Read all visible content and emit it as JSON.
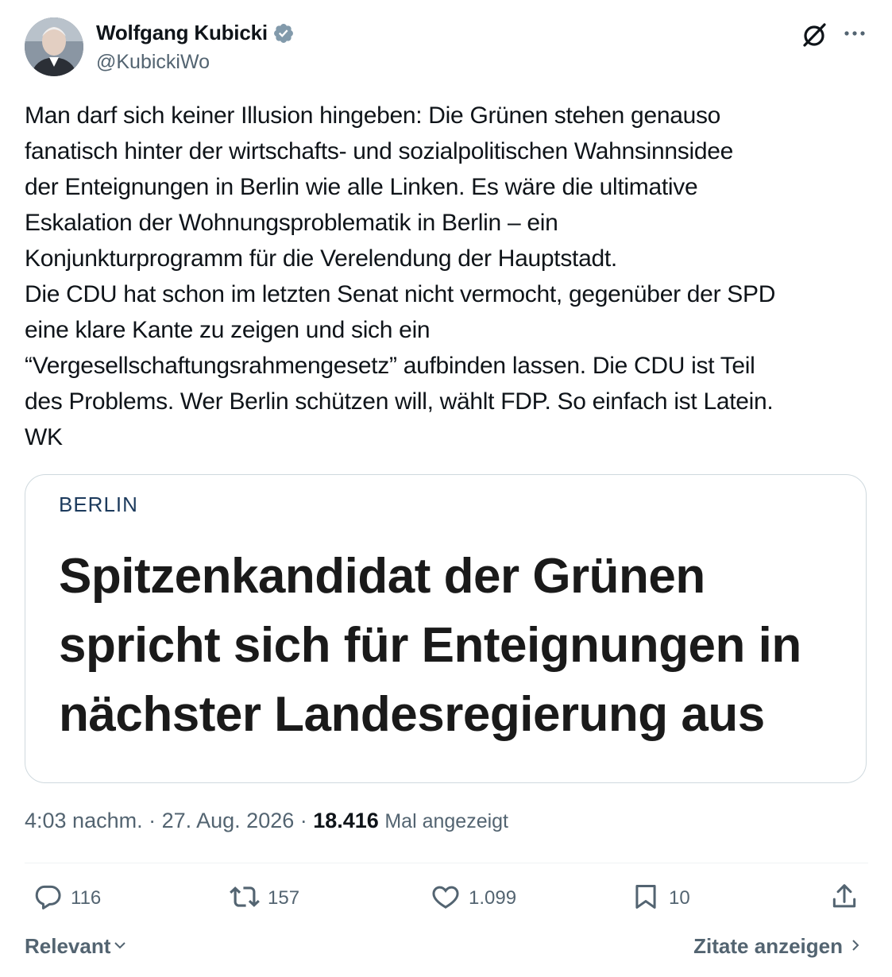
{
  "author": {
    "name": "Wolfgang Kubicki",
    "handle": "@KubickiWo",
    "verified_color": "#829aab"
  },
  "tweet": {
    "lines": [
      "Man darf sich keiner Illusion hingeben: Die Grünen stehen genauso",
      "fanatisch hinter der wirtschafts- und sozialpolitischen Wahnsinnsidee",
      "der Enteignungen in Berlin wie alle Linken. Es wäre die ultimative",
      "Eskalation der Wohnungsproblematik in Berlin – ein",
      "Konjunkturprogramm für die Verelendung der Hauptstadt.",
      "Die CDU hat schon im letzten Senat nicht vermocht, gegenüber der SPD",
      "eine klare Kante zu zeigen und sich ein",
      "“Vergesellschaftungsrahmengesetz” aufbinden lassen. Die CDU ist Teil",
      "des Problems. Wer Berlin schützen will, wählt FDP. So einfach ist Latein.",
      "WK"
    ]
  },
  "card": {
    "kicker": "BERLIN",
    "headline_lines": [
      "Spitzenkandidat der Grünen",
      "spricht sich für Enteignungen in",
      "nächster Landesregierung aus"
    ]
  },
  "meta": {
    "timestamp": "4:03 nachm. · 27. Aug. 2026 · ",
    "views_count": "18.416",
    "views_label": "Mal angezeigt"
  },
  "actions": {
    "replies": "116",
    "reposts": "157",
    "likes": "1.099",
    "bookmarks": "10"
  },
  "footer": {
    "sort_label": "Relevant",
    "quotes_label": "Zitate anzeigen"
  },
  "icons": {
    "verified": "verified-badge-icon",
    "grok": "grok-icon",
    "more": "more-icon",
    "reply": "reply-icon",
    "repost": "repost-icon",
    "like": "like-icon",
    "bookmark": "bookmark-icon",
    "share": "share-icon"
  }
}
